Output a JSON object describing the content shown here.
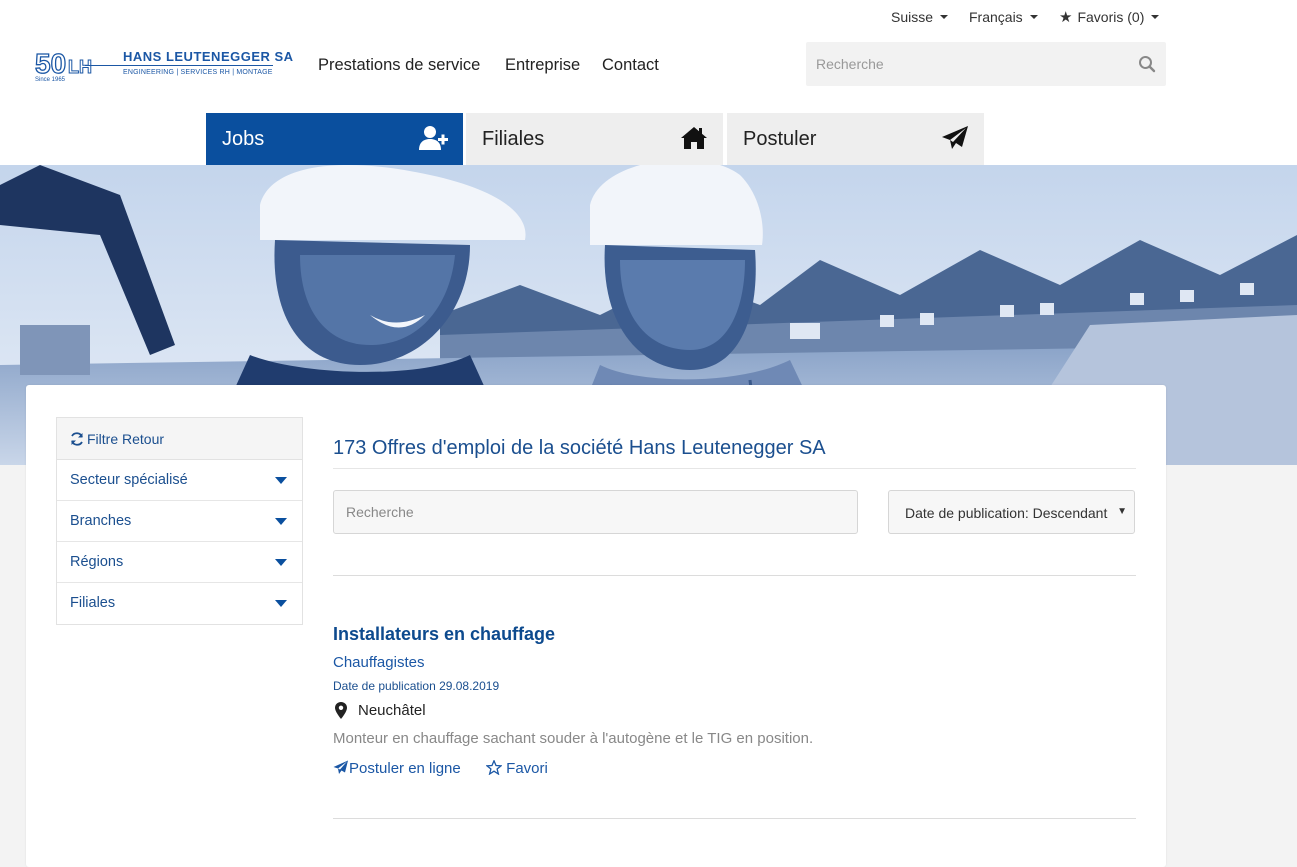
{
  "utility": {
    "country": "Suisse",
    "language": "Français",
    "favorites": "Favoris (0)"
  },
  "logo": {
    "mark": "50",
    "mark_sub": "LH",
    "since": "Since 1965",
    "company": "HANS LEUTENEGGER SA",
    "tagline": "ENGINEERING | SERVICES RH | MONTAGE"
  },
  "nav": {
    "items": [
      "Prestations de service",
      "Entreprise",
      "Contact"
    ]
  },
  "top_search": {
    "placeholder": "Recherche"
  },
  "tabs": [
    {
      "label": "Jobs",
      "icon": "user-plus-icon",
      "active": true
    },
    {
      "label": "Filiales",
      "icon": "home-icon",
      "active": false
    },
    {
      "label": "Postuler",
      "icon": "paper-plane-icon",
      "active": false
    }
  ],
  "filter": {
    "reset_label": "Filtre Retour",
    "rows": [
      "Secteur spécialisé",
      "Branches",
      "Régions",
      "Filiales"
    ]
  },
  "results": {
    "heading": "173 Offres d'emploi de la société Hans Leutenegger SA",
    "search_placeholder": "Recherche",
    "sort_value": "Date de publication: Descendant"
  },
  "jobs": [
    {
      "title": "Installateurs en chauffage",
      "subtitle": "Chauffagistes",
      "date": "Date de publication 29.08.2019",
      "location": "Neuchâtel",
      "description": "Monteur en chauffage sachant souder à l'autogène et le TIG en position.",
      "apply_label": "Postuler en ligne",
      "favorite_label": "Favori"
    }
  ],
  "colors": {
    "brand_blue": "#0a4f9e",
    "link_blue": "#1b57a5",
    "tab_inactive": "#eeeeee"
  }
}
